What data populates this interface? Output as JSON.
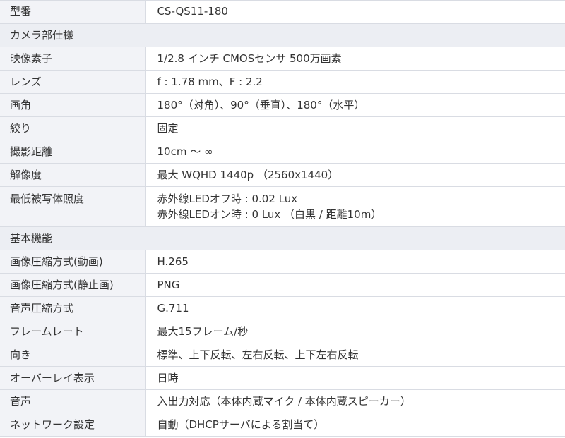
{
  "rows": [
    {
      "kind": "row",
      "label": "型番",
      "lines": [
        "CS-QS11-180"
      ]
    },
    {
      "kind": "section",
      "label": "カメラ部仕様"
    },
    {
      "kind": "row",
      "label": "映像素子",
      "lines": [
        "1/2.8 インチ CMOSセンサ 500万画素"
      ]
    },
    {
      "kind": "row",
      "label": "レンズ",
      "lines": [
        "f : 1.78 mm、F : 2.2"
      ]
    },
    {
      "kind": "row",
      "label": "画角",
      "lines": [
        "180°（対角）、90°（垂直）、180°（水平）"
      ]
    },
    {
      "kind": "row",
      "label": "絞り",
      "lines": [
        "固定"
      ]
    },
    {
      "kind": "row",
      "label": "撮影距離",
      "lines": [
        "10cm ～ ∞"
      ]
    },
    {
      "kind": "row",
      "label": "解像度",
      "lines": [
        "最大 WQHD 1440p （2560x1440）"
      ]
    },
    {
      "kind": "row",
      "label": "最低被写体照度",
      "lines": [
        "赤外線LEDオフ時 : 0.02 Lux",
        "赤外線LEDオン時 : 0 Lux （白黒 / 距離10m）"
      ]
    },
    {
      "kind": "section",
      "label": "基本機能"
    },
    {
      "kind": "row",
      "label": "画像圧縮方式(動画)",
      "lines": [
        "H.265"
      ]
    },
    {
      "kind": "row",
      "label": "画像圧縮方式(静止画)",
      "lines": [
        "PNG"
      ]
    },
    {
      "kind": "row",
      "label": "音声圧縮方式",
      "lines": [
        "G.711"
      ]
    },
    {
      "kind": "row",
      "label": "フレームレート",
      "lines": [
        "最大15フレーム/秒"
      ]
    },
    {
      "kind": "row",
      "label": "向き",
      "lines": [
        "標準、上下反転、左右反転、上下左右反転"
      ]
    },
    {
      "kind": "row",
      "label": "オーバーレイ表示",
      "lines": [
        "日時"
      ]
    },
    {
      "kind": "row",
      "label": "音声",
      "lines": [
        "入出力対応（本体内蔵マイク / 本体内蔵スピーカー）"
      ]
    },
    {
      "kind": "row",
      "label": "ネットワーク設定",
      "lines": [
        "自動（DHCPサーバによる割当て）"
      ]
    }
  ]
}
